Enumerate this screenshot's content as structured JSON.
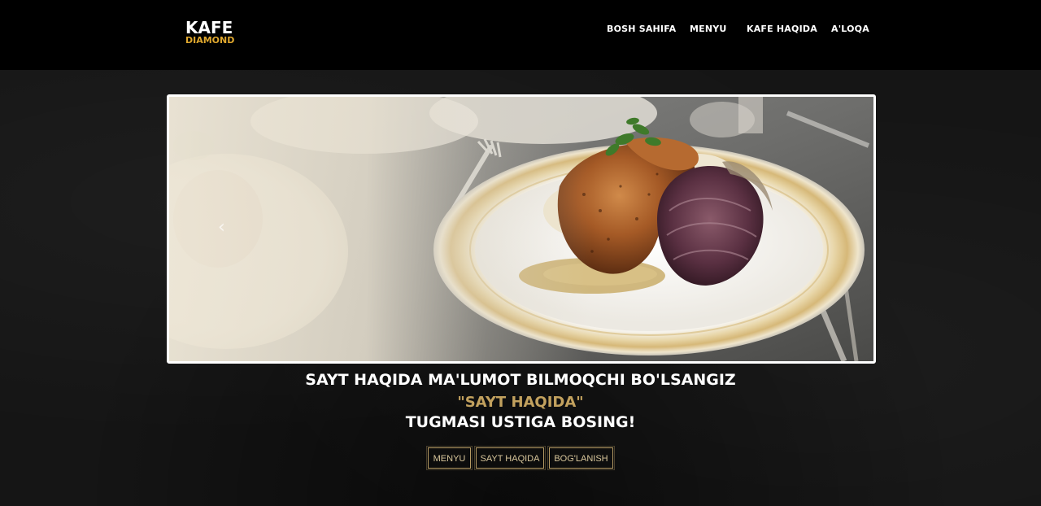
{
  "header": {
    "logo": {
      "line1": "KAFE",
      "line2": "DIAMOND"
    },
    "nav": [
      {
        "label": "BOSH SAHIFA"
      },
      {
        "label": "MENYU"
      },
      {
        "label": "KAFE HAQIDA"
      },
      {
        "label": "A'LOQA"
      }
    ]
  },
  "slider": {
    "prev_icon": "chevron-left-icon",
    "prev_glyph": "‹",
    "image_subject": "plated roasted chicken with artichoke"
  },
  "hero": {
    "line1": "SAYT HAQIDA MA'LUMOT BILMOQCHI BO'LSANGIZ",
    "line2": "\"SAYT HAQIDA\"",
    "line3": "TUGMASI USTIGA BOSING!"
  },
  "buttons": [
    {
      "label": "MENYU"
    },
    {
      "label": "SAYT HAQIDA"
    },
    {
      "label": "BOG'LANISH"
    }
  ],
  "colors": {
    "header_bg": "#000000",
    "page_bg": "#151515",
    "logo_accent": "#e0a82e",
    "gold_text": "#c2a15e",
    "button_border": "#b59a63"
  }
}
